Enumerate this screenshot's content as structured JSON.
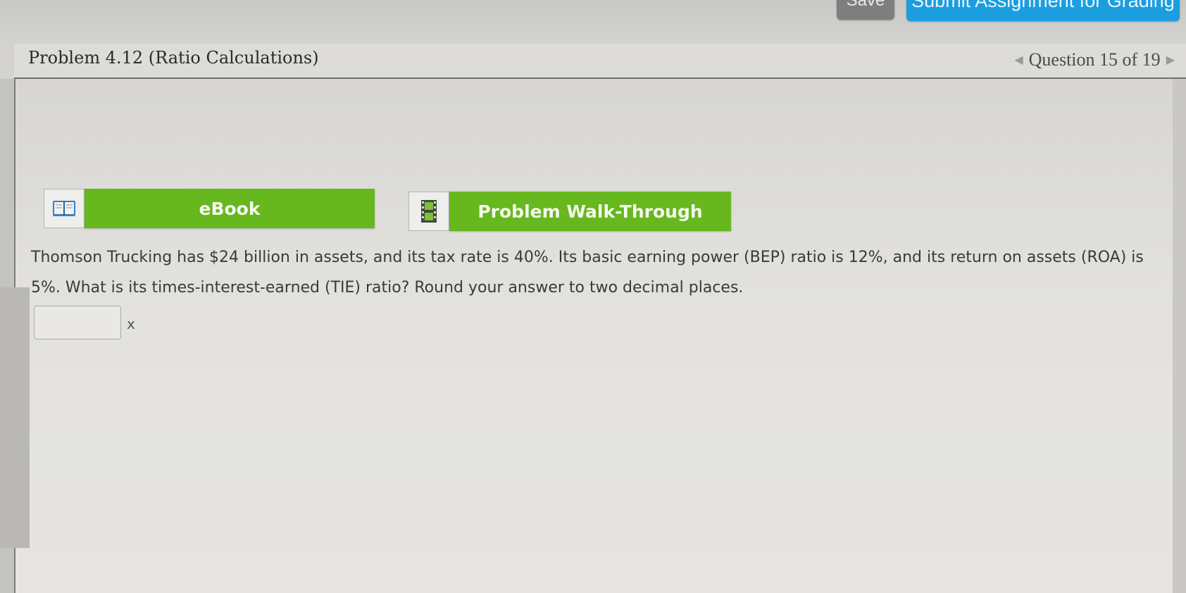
{
  "toolbar": {
    "save_label": "Save",
    "submit_label": "Submit Assignment for Grading"
  },
  "header": {
    "title": "Problem 4.12 (Ratio Calculations)",
    "question_nav": "Question 15 of 19"
  },
  "resources": {
    "ebook_label": "eBook",
    "walkthrough_label": "Problem Walk-Through"
  },
  "problem": {
    "text": "Thomson Trucking has $24 billion in assets, and its tax rate is 40%. Its basic earning power (BEP) ratio is 12%, and its return on assets (ROA) is 5%. What is its times-interest-earned (TIE) ratio? Round your answer to two decimal places.",
    "answer_value": "",
    "answer_unit": "x"
  },
  "colors": {
    "submit_blue": "#1a9ee0",
    "resource_green": "#67b71e",
    "save_gray": "#7d7e7e"
  }
}
